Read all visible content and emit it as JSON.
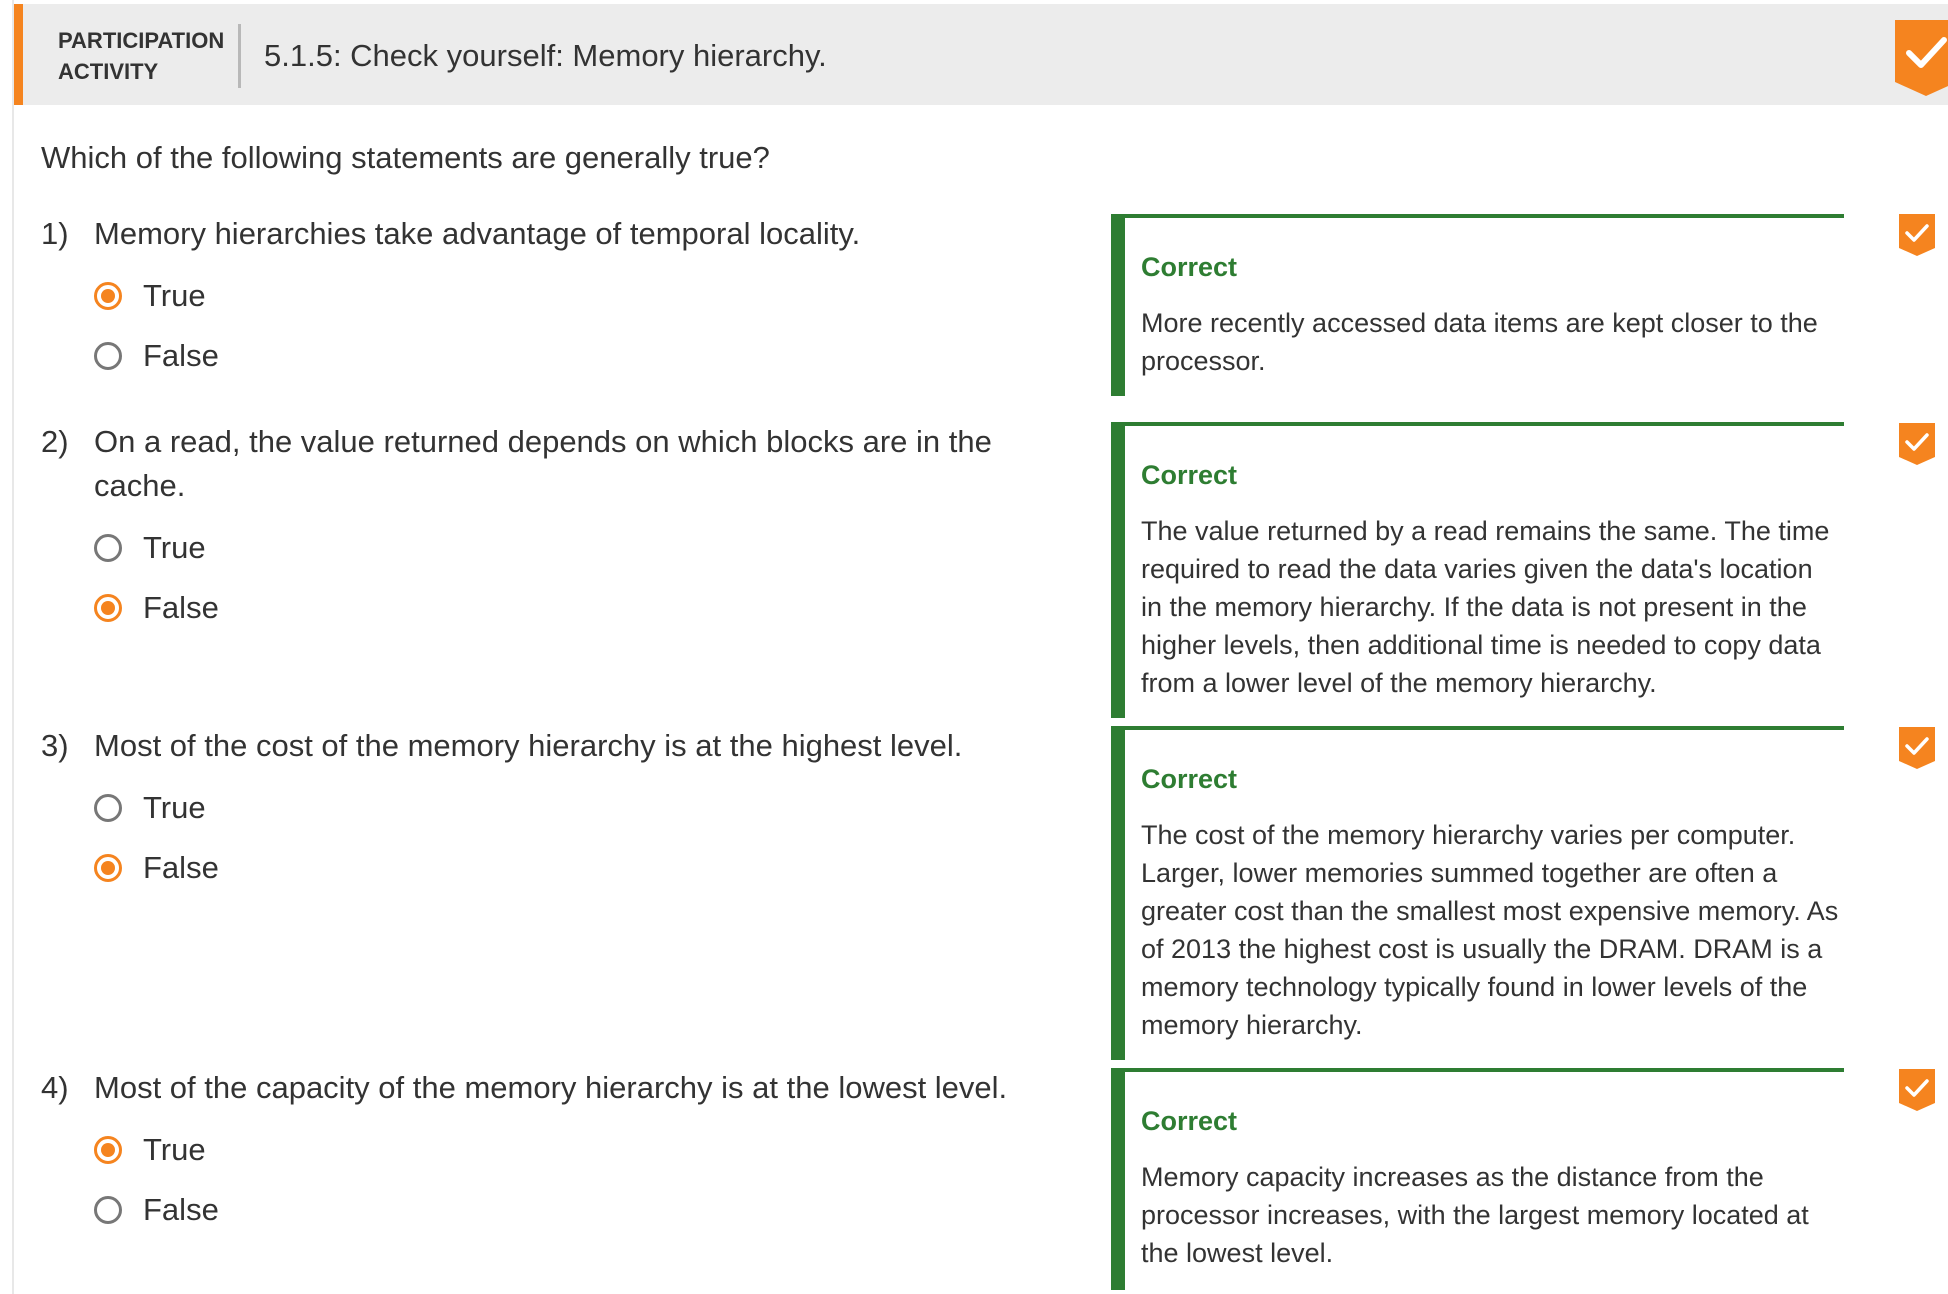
{
  "header": {
    "label_line1": "PARTICIPATION",
    "label_line2": "ACTIVITY",
    "title": "5.1.5: Check yourself: Memory hierarchy."
  },
  "colors": {
    "accent": "#f5841f",
    "correct": "#2e7d32",
    "header_bg": "#ececec"
  },
  "icons": {
    "completion": "checkmark-badge-icon",
    "radio": "radio-button"
  },
  "instruction": "Which of the following statements are generally true?",
  "questions": [
    {
      "number": "1)",
      "text": "Memory hierarchies take advantage of temporal locality.",
      "options": [
        "True",
        "False"
      ],
      "selected": "True",
      "feedback": {
        "title": "Correct",
        "text": "More recently accessed data items are kept closer to the processor."
      }
    },
    {
      "number": "2)",
      "text": "On a read, the value returned depends on which blocks are in the cache.",
      "options": [
        "True",
        "False"
      ],
      "selected": "False",
      "feedback": {
        "title": "Correct",
        "text": "The value returned by a read remains the same. The time required to read the data varies given the data's location in the memory hierarchy. If the data is not present in the higher levels, then additional time is needed to copy data from a lower level of the memory hierarchy."
      }
    },
    {
      "number": "3)",
      "text": "Most of the cost of the memory hierarchy is at the highest level.",
      "options": [
        "True",
        "False"
      ],
      "selected": "False",
      "feedback": {
        "title": "Correct",
        "text": "The cost of the memory hierarchy varies per computer. Larger, lower memories summed together are often a greater cost than the smallest most expensive memory. As of 2013 the highest cost is usually the DRAM. DRAM is a memory technology typically found in lower levels of the memory hierarchy."
      }
    },
    {
      "number": "4)",
      "text": "Most of the capacity of the memory hierarchy is at the lowest level.",
      "options": [
        "True",
        "False"
      ],
      "selected": "True",
      "feedback": {
        "title": "Correct",
        "text": "Memory capacity increases as the distance from the processor increases, with the largest memory located at the lowest level."
      }
    }
  ]
}
